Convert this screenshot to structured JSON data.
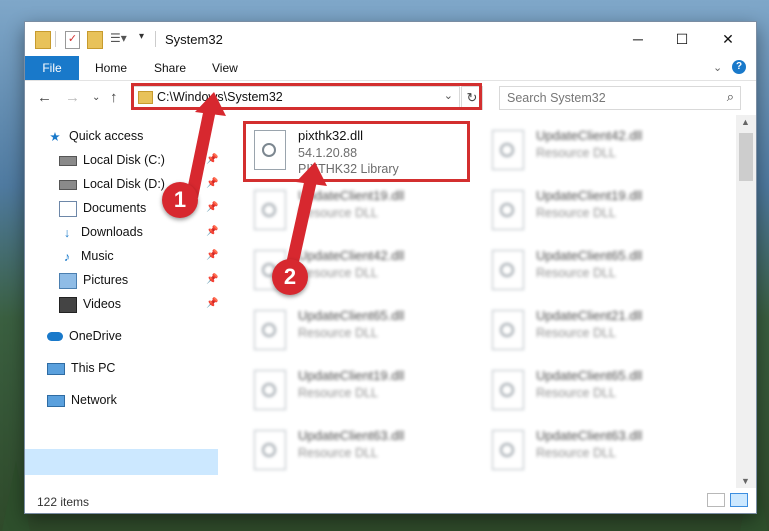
{
  "window": {
    "title": "System32",
    "controls": {
      "minimize": "─",
      "maximize": "☐",
      "close": "✕"
    }
  },
  "ribbon": {
    "tabs": [
      "File",
      "Home",
      "Share",
      "View"
    ],
    "help_icon": "?"
  },
  "address": {
    "path": "C:\\Windows\\System32",
    "search_placeholder": "Search System32"
  },
  "sidebar": {
    "items": [
      {
        "label": "Quick access",
        "icon": "star-icon",
        "pinned": false
      },
      {
        "label": "Local Disk (C:)",
        "icon": "drive-icon",
        "pinned": true
      },
      {
        "label": "Local Disk (D:)",
        "icon": "drive-icon",
        "pinned": true
      },
      {
        "label": "Documents",
        "icon": "documents-icon",
        "pinned": true
      },
      {
        "label": "Downloads",
        "icon": "downloads-icon",
        "pinned": true
      },
      {
        "label": "Music",
        "icon": "music-icon",
        "pinned": true
      },
      {
        "label": "Pictures",
        "icon": "pictures-icon",
        "pinned": true
      },
      {
        "label": "Videos",
        "icon": "videos-icon",
        "pinned": true
      },
      {
        "label": "OneDrive",
        "icon": "cloud-icon",
        "pinned": false
      },
      {
        "label": "This PC",
        "icon": "computer-icon",
        "pinned": false,
        "selected": true
      },
      {
        "label": "Network",
        "icon": "network-icon",
        "pinned": false
      }
    ]
  },
  "files": [
    {
      "name": "pixthk32.dll",
      "version": "54.1.20.88",
      "description": "PIXTHK32 Library",
      "highlighted": true
    },
    {
      "name": "UpdateClient42.dll",
      "description": "Resource DLL"
    },
    {
      "name": "UpdateClient19.dll",
      "description": "Resource DLL"
    },
    {
      "name": "UpdateClient19.dll",
      "description": "Resource DLL"
    },
    {
      "name": "UpdateClient42.dll",
      "description": "Resource DLL"
    },
    {
      "name": "UpdateClient65.dll",
      "description": "Resource DLL"
    },
    {
      "name": "UpdateClient65.dll",
      "description": "Resource DLL"
    },
    {
      "name": "UpdateClient21.dll",
      "description": "Resource DLL"
    },
    {
      "name": "UpdateClient19.dll",
      "description": "Resource DLL"
    },
    {
      "name": "UpdateClient65.dll",
      "description": "Resource DLL"
    },
    {
      "name": "UpdateClient63.dll",
      "description": "Resource DLL"
    },
    {
      "name": "UpdateClient63.dll",
      "description": "Resource DLL"
    }
  ],
  "status": {
    "item_count": "122 items"
  },
  "annotations": {
    "step1": "1",
    "step2": "2",
    "color": "#d7282f"
  }
}
